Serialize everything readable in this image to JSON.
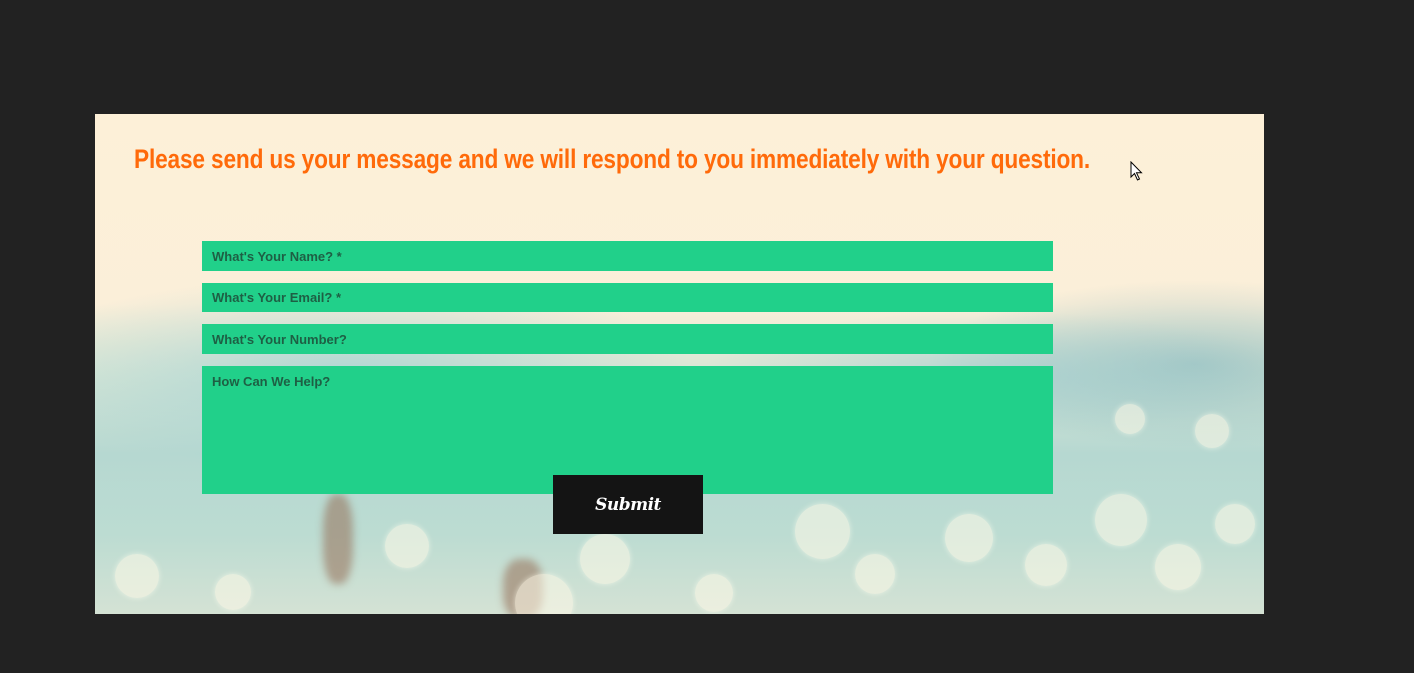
{
  "contact_section": {
    "headline": "Please send us your message and we will respond to you immediately with your question."
  },
  "form": {
    "name_placeholder": "What's Your Name? *",
    "email_placeholder": "What's Your Email? *",
    "number_placeholder": "What's Your Number?",
    "message_placeholder": "How Can We Help?",
    "submit_label": "Submit"
  },
  "colors": {
    "page_background": "#222222",
    "headline": "#ff6a0a",
    "field_background": "#21d08a",
    "button_background": "#141414"
  },
  "icons": {
    "cursor": "mouse-pointer-icon"
  }
}
